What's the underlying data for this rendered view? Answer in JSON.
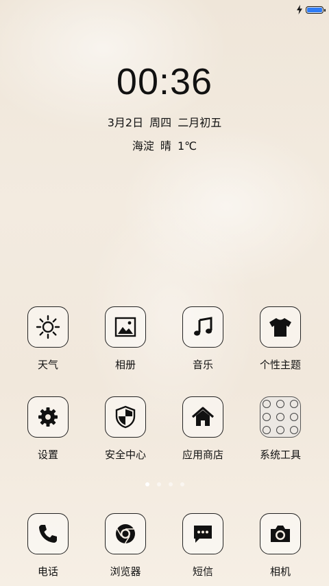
{
  "status_bar": {
    "charging_icon": "bolt-icon",
    "battery_level": 1.0,
    "battery_color": "#2f7cf6"
  },
  "lockscreen": {
    "time": "00:36",
    "date": "3月2日 周四 二月初五",
    "weather": "海淀 晴 1℃"
  },
  "apps": {
    "weather": {
      "label": "天气",
      "icon": "sun-icon"
    },
    "gallery": {
      "label": "相册",
      "icon": "image-icon"
    },
    "music": {
      "label": "音乐",
      "icon": "music-note-icon"
    },
    "themes": {
      "label": "个性主题",
      "icon": "tshirt-icon"
    },
    "settings": {
      "label": "设置",
      "icon": "gear-icon"
    },
    "security": {
      "label": "安全中心",
      "icon": "shield-icon"
    },
    "appstore": {
      "label": "应用商店",
      "icon": "home-icon"
    },
    "tools": {
      "label": "系统工具",
      "icon": "folder-icon"
    }
  },
  "page_indicator": {
    "pages": 4,
    "current": 1
  },
  "dock": {
    "phone": {
      "label": "电话",
      "icon": "phone-icon"
    },
    "browser": {
      "label": "浏览器",
      "icon": "chrome-icon"
    },
    "sms": {
      "label": "短信",
      "icon": "chat-icon"
    },
    "camera": {
      "label": "相机",
      "icon": "camera-icon"
    }
  }
}
